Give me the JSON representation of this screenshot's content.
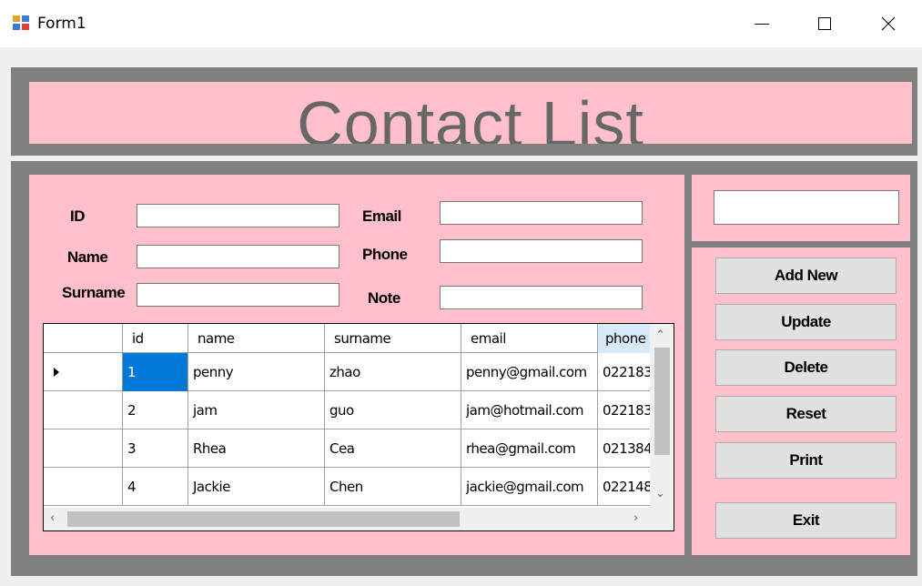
{
  "window": {
    "title": "Form1",
    "icon": "form-app-icon"
  },
  "header": {
    "title": "Contact List"
  },
  "form": {
    "id_label": "ID",
    "name_label": "Name",
    "surname_label": "Surname",
    "email_label": "Email",
    "phone_label": "Phone",
    "note_label": "Note",
    "id_value": "",
    "name_value": "",
    "surname_value": "",
    "email_value": "",
    "phone_value": "",
    "note_value": ""
  },
  "search": {
    "value": ""
  },
  "grid": {
    "columns": [
      "id",
      "name",
      "surname",
      "email",
      "phone"
    ],
    "rows": [
      {
        "id": "1",
        "name": "penny",
        "surname": "zhao",
        "email": "penny@gmail.com",
        "phone": "022183"
      },
      {
        "id": "2",
        "name": "jam",
        "surname": "guo",
        "email": "jam@hotmail.com",
        "phone": "022183"
      },
      {
        "id": "3",
        "name": "Rhea",
        "surname": "Cea",
        "email": "rhea@gmail.com",
        "phone": "021384"
      },
      {
        "id": "4",
        "name": "Jackie",
        "surname": "Chen",
        "email": "jackie@gmail.com",
        "phone": "022148"
      }
    ]
  },
  "buttons": {
    "add_new": "Add New",
    "update": "Update",
    "delete": "Delete",
    "reset": "Reset",
    "print": "Print",
    "exit": "Exit"
  },
  "colors": {
    "panel_pink": "#ffc0cb",
    "frame_gray": "#808080",
    "selection_blue": "#0078d7"
  }
}
